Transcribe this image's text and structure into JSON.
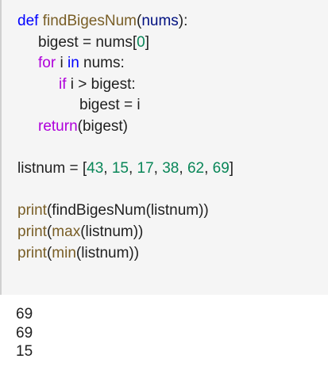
{
  "code": {
    "line1": {
      "kw": "def",
      "fn": "findBigesNum",
      "open": "(",
      "param": "nums",
      "close": "):"
    },
    "line2": {
      "lhs": "bigest = ",
      "rhs_var": "nums",
      "lb": "[",
      "idx": "0",
      "rb": "]"
    },
    "line3": {
      "kw_for": "for",
      "loopvar": " i ",
      "kw_in": "in",
      "iter": " nums:"
    },
    "line4": {
      "kw_if": "if",
      "cond": " i > bigest:"
    },
    "line5": {
      "stmt": "bigest = i"
    },
    "line6": {
      "kw_return": "return",
      "arg": "(bigest)"
    },
    "line8": {
      "lhs": "listnum = [",
      "values": [
        "43",
        "15",
        "17",
        "38",
        "62",
        "69"
      ],
      "sep": ", ",
      "rb": "]"
    },
    "line10": {
      "fn_print": "print",
      "rest": "(findBigesNum(listnum))"
    },
    "line11": {
      "fn_print": "print",
      "open": "(",
      "fn_max": "max",
      "rest": "(listnum))"
    },
    "line12": {
      "fn_print": "print",
      "open": "(",
      "fn_min": "min",
      "rest": "(listnum))"
    }
  },
  "output": [
    "69",
    "69",
    "15"
  ]
}
